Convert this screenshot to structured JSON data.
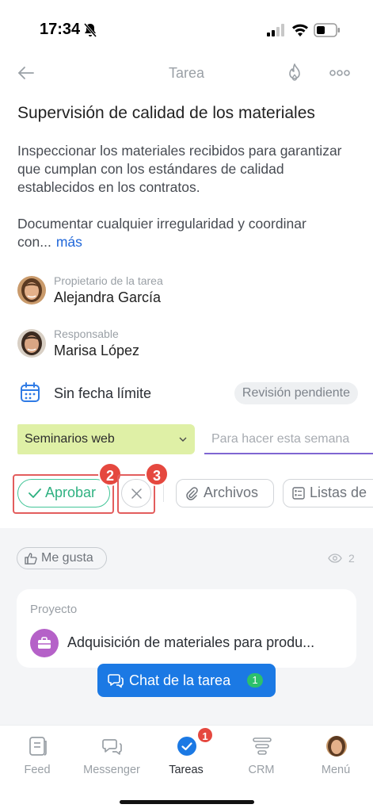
{
  "status_bar": {
    "time": "17:34"
  },
  "nav": {
    "title": "Tarea",
    "back_icon": "arrow-left-icon",
    "flame_icon": "flame-icon",
    "more_icon": "more-dots-icon"
  },
  "task": {
    "title": "Supervisión de calidad de los materiales",
    "description_1": "Inspeccionar los materiales recibidos para garantizar que cumplan con los estándares de calidad establecidos en los contratos.",
    "description_2": "Documentar cualquier irregularidad y coordinar con...",
    "more_link": "más"
  },
  "owner": {
    "role": "Propietario de la tarea",
    "name": "Alejandra García"
  },
  "assignee": {
    "role": "Responsable",
    "name": "Marisa López"
  },
  "deadline": {
    "text": "Sin fecha límite",
    "status_badge": "Revisión pendiente"
  },
  "stages": {
    "current": "Seminarios web",
    "next": "Para hacer esta semana"
  },
  "actions": {
    "approve_label": "Aprobar",
    "files_label": "Archivos",
    "lists_label": "Listas de",
    "highlight_approve": "2",
    "highlight_reject": "3"
  },
  "feedback": {
    "like_label": "Me gusta",
    "views_count": "2"
  },
  "project": {
    "label": "Proyecto",
    "name": "Adquisición de materiales para produ..."
  },
  "chat": {
    "label": "Chat de la tarea",
    "count": "1"
  },
  "tabbar": {
    "tabs": [
      {
        "label": "Feed",
        "icon": "feed-icon"
      },
      {
        "label": "Messenger",
        "icon": "chat-icon"
      },
      {
        "label": "Tareas",
        "icon": "tasks-check-icon"
      },
      {
        "label": "CRM",
        "icon": "crm-funnel-icon"
      },
      {
        "label": "Menú",
        "icon": "avatar"
      }
    ],
    "tasks_badge": "1"
  },
  "colors": {
    "accent": "#1b79e4",
    "approve": "#2fb181",
    "highlight": "#e5483f",
    "stage": "#dff0a6"
  }
}
